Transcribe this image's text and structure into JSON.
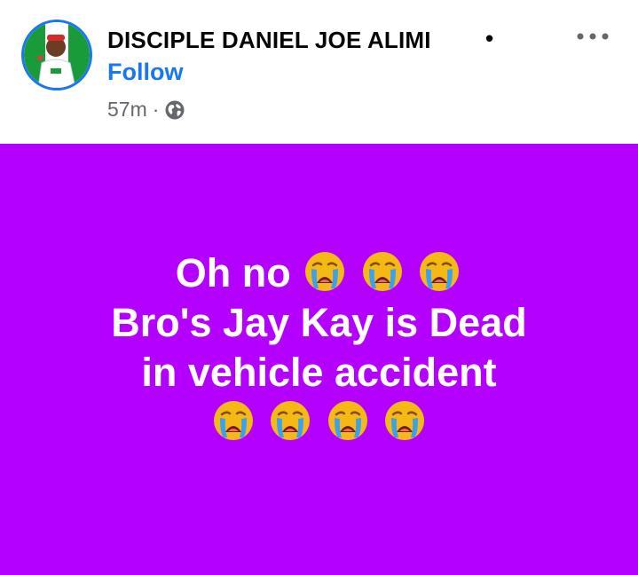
{
  "post": {
    "author": "DISCIPLE DANIEL JOE ALIMI",
    "name_dot": "•",
    "follow_label": "Follow",
    "time": "57m",
    "time_separator": "·",
    "privacy_icon": "globe-icon",
    "more_icon": "more-options-icon",
    "background_color": "#b400ff",
    "lines": {
      "line1_text": "Oh no",
      "line2_text": "Bro's Jay Kay is Dead",
      "line3_text": "in vehicle accident"
    },
    "emoji_icon": "loudly-crying-face-icon"
  }
}
